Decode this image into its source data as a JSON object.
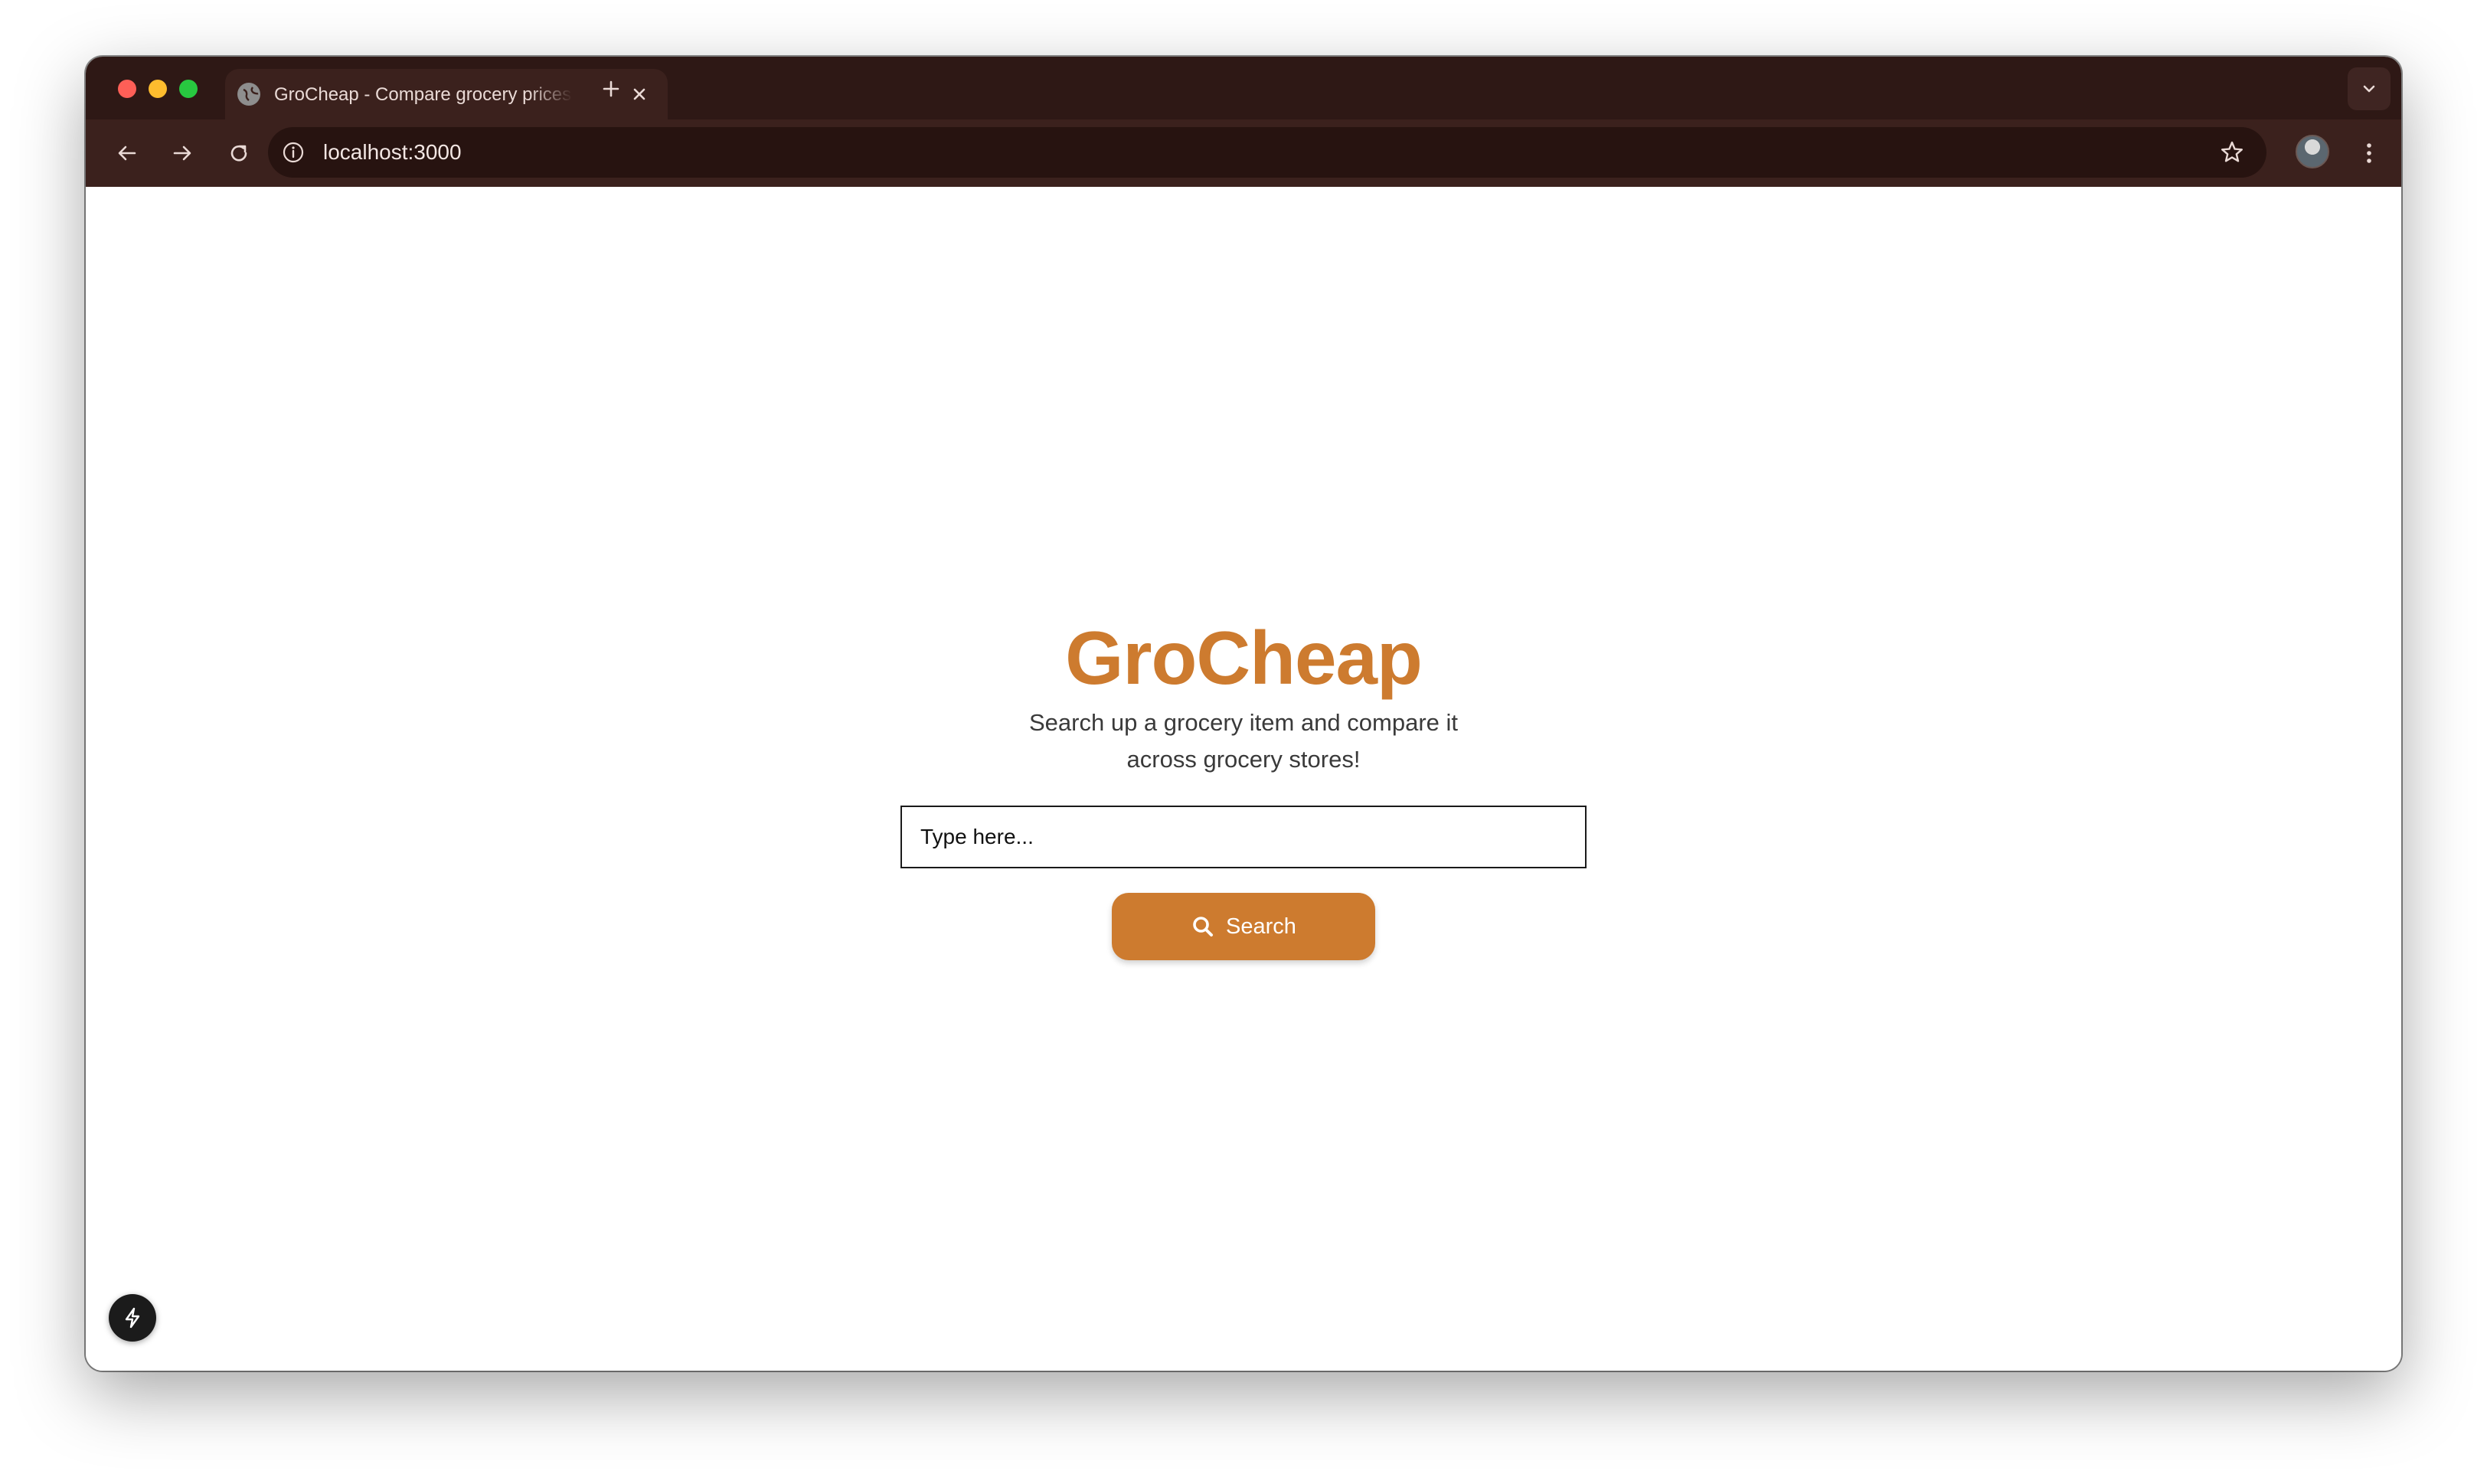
{
  "browser": {
    "tab": {
      "title": "GroCheap - Compare grocery prices",
      "favicon": "globe-icon",
      "close_icon": "close-icon"
    },
    "new_tab_icon": "plus-icon",
    "tab_menu_icon": "chevron-down-icon",
    "toolbar": {
      "back_icon": "arrow-left-icon",
      "forward_icon": "arrow-right-icon",
      "reload_icon": "reload-icon",
      "site_info_icon": "info-icon",
      "url": "localhost:3000",
      "bookmark_icon": "star-icon",
      "profile_icon": "avatar",
      "menu_icon": "kebab-menu-icon"
    },
    "colors": {
      "tabstrip": "#2e1815",
      "toolbar": "#3b211d",
      "omnibox": "#271310"
    }
  },
  "page": {
    "title": "GroCheap",
    "subtitle_line1": "Search up a grocery item and compare it",
    "subtitle_line2": "across grocery stores!",
    "search": {
      "placeholder": "Type here...",
      "value": ""
    },
    "search_button": {
      "label": "Search",
      "icon": "search-icon"
    },
    "dev_badge_icon": "lightning-icon",
    "colors": {
      "accent": "#cd7b2f",
      "text": "#3a3a3a",
      "background": "#ffffff"
    }
  }
}
